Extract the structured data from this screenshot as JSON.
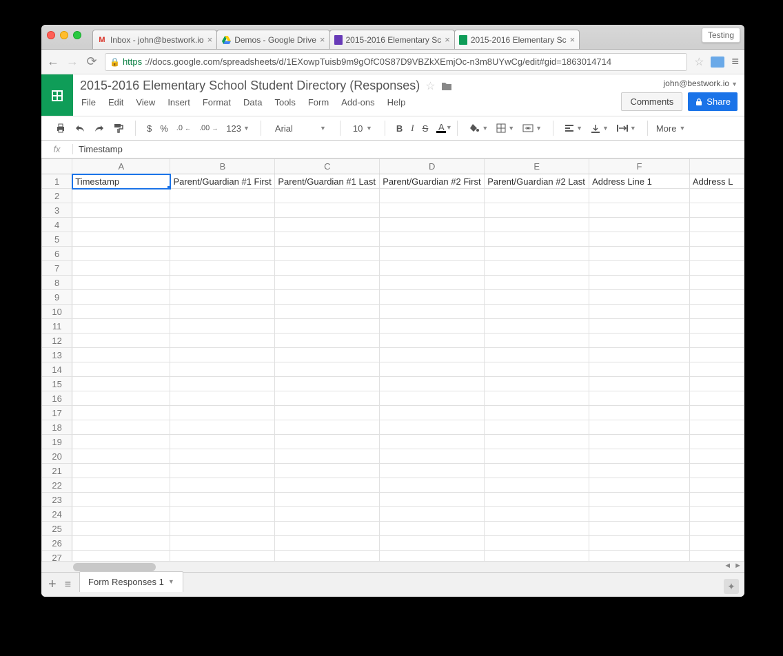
{
  "browser": {
    "testing_badge": "Testing",
    "tabs": [
      {
        "title": "Inbox - john@bestwork.io",
        "icon": "gmail"
      },
      {
        "title": "Demos - Google Drive",
        "icon": "drive"
      },
      {
        "title": "2015-2016 Elementary Sc",
        "icon": "forms"
      },
      {
        "title": "2015-2016 Elementary Sc",
        "icon": "sheets",
        "active": true
      }
    ],
    "url_https": "https",
    "url_rest": "://docs.google.com/spreadsheets/d/1EXowpTuisb9m9gOfC0S87D9VBZkXEmjOc-n3m8UYwCg/edit#gid=1863014714"
  },
  "doc": {
    "title": "2015-2016 Elementary School Student Directory (Responses)",
    "account": "john@bestwork.io",
    "menus": [
      "File",
      "Edit",
      "View",
      "Insert",
      "Format",
      "Data",
      "Tools",
      "Form",
      "Add-ons",
      "Help"
    ],
    "comments_btn": "Comments",
    "share_btn": "Share"
  },
  "toolbar": {
    "currency": "$",
    "percent": "%",
    "dec_dec": ".0",
    "dec_inc": ".00",
    "numfmt": "123",
    "font": "Arial",
    "size": "10",
    "more": "More"
  },
  "formula": {
    "label": "fx",
    "value": "Timestamp"
  },
  "grid": {
    "columns": [
      "A",
      "B",
      "C",
      "D",
      "E",
      "F"
    ],
    "overflow_col_hint": "Address L",
    "row_count": 27,
    "headers": [
      "Timestamp",
      "Parent/Guardian #1 First",
      "Parent/Guardian #1 Last",
      "Parent/Guardian #2 First",
      "Parent/Guardian #2 Last",
      "Address Line 1"
    ],
    "selected": "A1"
  },
  "footer": {
    "sheet_tab": "Form Responses 1"
  }
}
